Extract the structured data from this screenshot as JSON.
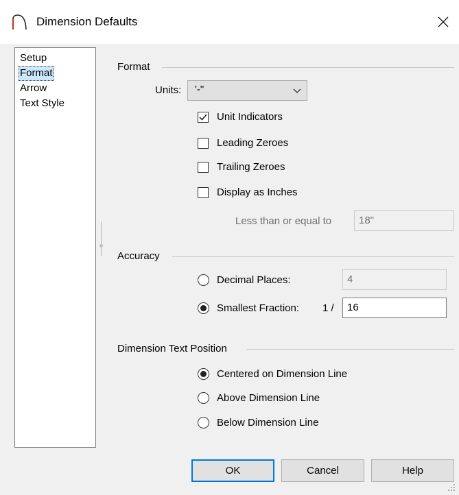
{
  "window": {
    "title": "Dimension Defaults",
    "close_label": "×"
  },
  "sidebar": {
    "items": [
      {
        "label": "Setup"
      },
      {
        "label": "Format"
      },
      {
        "label": "Arrow"
      },
      {
        "label": "Text Style"
      }
    ],
    "selected": "Format"
  },
  "format": {
    "group_title": "Format",
    "units_label": "Units:",
    "units_value": "'-\"",
    "unit_indicators": {
      "label": "Unit Indicators",
      "checked": true
    },
    "leading_zeroes": {
      "label": "Leading Zeroes",
      "checked": false
    },
    "trailing_zeroes": {
      "label": "Trailing Zeroes",
      "checked": false
    },
    "display_as_inches": {
      "label": "Display as Inches",
      "checked": false
    },
    "less_than_label": "Less than or equal to",
    "less_than_value": "18\""
  },
  "accuracy": {
    "group_title": "Accuracy",
    "decimal_places": {
      "label": "Decimal Places:",
      "value": "4",
      "selected": false
    },
    "smallest_fraction": {
      "label": "Smallest Fraction:",
      "prefix": "1 /",
      "value": "16",
      "selected": true
    }
  },
  "text_position": {
    "group_title": "Dimension Text Position",
    "options": [
      {
        "label": "Centered on Dimension Line",
        "selected": true
      },
      {
        "label": "Above Dimension Line",
        "selected": false
      },
      {
        "label": "Below Dimension Line",
        "selected": false
      }
    ]
  },
  "buttons": {
    "ok": "OK",
    "cancel": "Cancel",
    "help": "Help"
  }
}
